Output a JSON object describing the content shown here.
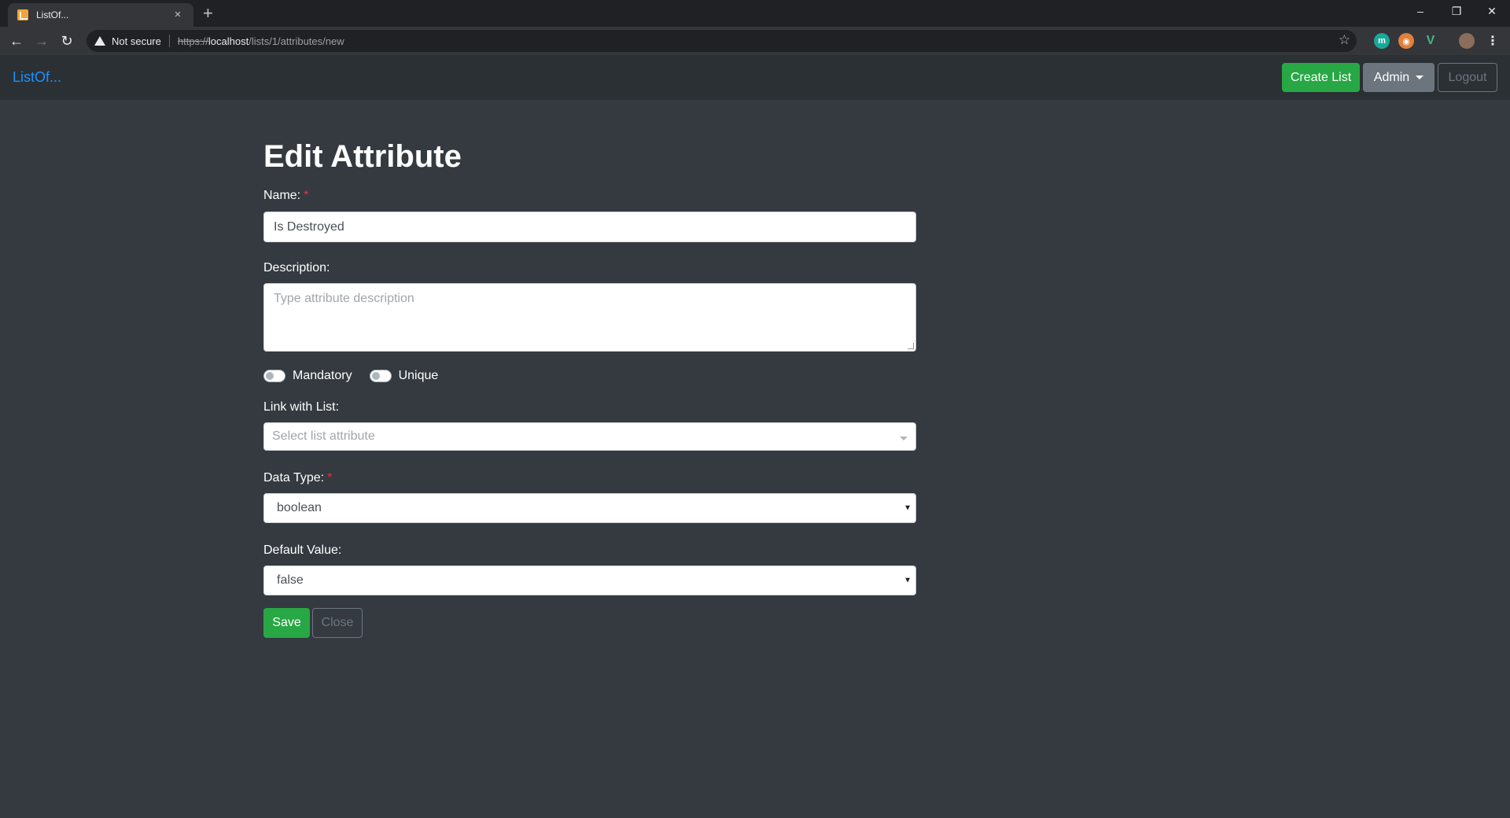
{
  "browser": {
    "tab_title": "ListOf...",
    "tab_close": "×",
    "new_tab": "+",
    "security_label": "Not secure",
    "url_scheme": "https://",
    "url_host": "localhost",
    "url_path": "/lists/1/attributes/new",
    "window_controls": [
      "–",
      "❐",
      "✕"
    ]
  },
  "navbar": {
    "brand": "ListOf...",
    "create_list": "Create List",
    "admin": "Admin",
    "logout": "Logout"
  },
  "form": {
    "title": "Edit Attribute",
    "name_label": "Name:",
    "name_value": "Is Destroyed",
    "description_label": "Description:",
    "description_placeholder": "Type attribute description",
    "mandatory_label": "Mandatory",
    "unique_label": "Unique",
    "link_label": "Link with List:",
    "link_placeholder": "Select list attribute",
    "datatype_label": "Data Type:",
    "datatype_value": "boolean",
    "default_label": "Default Value:",
    "default_value": "false",
    "required_marker": "*",
    "save": "Save",
    "close": "Close"
  }
}
